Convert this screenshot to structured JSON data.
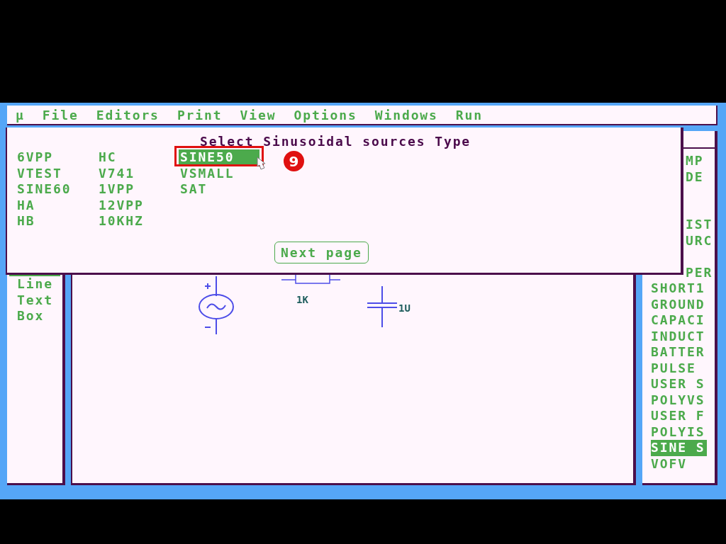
{
  "menu_bar": [
    "µ",
    "File",
    "Editors",
    "Print",
    "View",
    "Options",
    "Windows",
    "Run"
  ],
  "left_panel": {
    "items": [
      "Line",
      "Text",
      "Box"
    ]
  },
  "canvas": {
    "labels": [
      "1K",
      "1U"
    ]
  },
  "right_panel": {
    "partial_items": [
      "MP",
      "DE",
      "IST",
      "URC",
      "PER"
    ],
    "items": [
      {
        "label": "SHORT1",
        "selected": false
      },
      {
        "label": "GROUND",
        "selected": false
      },
      {
        "label": "CAPACI",
        "selected": false
      },
      {
        "label": "INDUCT",
        "selected": false
      },
      {
        "label": "BATTER",
        "selected": false
      },
      {
        "label": "PULSE",
        "selected": false
      },
      {
        "label": "USER S",
        "selected": false
      },
      {
        "label": "POLYVS",
        "selected": false
      },
      {
        "label": "USER F",
        "selected": false
      },
      {
        "label": "POLYIS",
        "selected": false
      },
      {
        "label": "SINE S",
        "selected": true
      },
      {
        "label": "VOFV",
        "selected": false
      }
    ]
  },
  "dialog": {
    "title": "Select Sinusoidal sources Type",
    "columns": [
      [
        {
          "label": "6VPP",
          "selected": false
        },
        {
          "label": "VTEST",
          "selected": false
        },
        {
          "label": "SINE60",
          "selected": false
        },
        {
          "label": "HA",
          "selected": false
        },
        {
          "label": "HB",
          "selected": false
        }
      ],
      [
        {
          "label": "HC",
          "selected": false
        },
        {
          "label": "V741",
          "selected": false
        },
        {
          "label": "1VPP",
          "selected": false
        },
        {
          "label": "12VPP",
          "selected": false
        },
        {
          "label": "10KHZ",
          "selected": false
        }
      ],
      [
        {
          "label": "SINE50",
          "selected": true
        },
        {
          "label": "VSMALL",
          "selected": false
        },
        {
          "label": "SAT",
          "selected": false
        }
      ]
    ],
    "button": "Next page"
  },
  "callout": {
    "number": "9"
  }
}
